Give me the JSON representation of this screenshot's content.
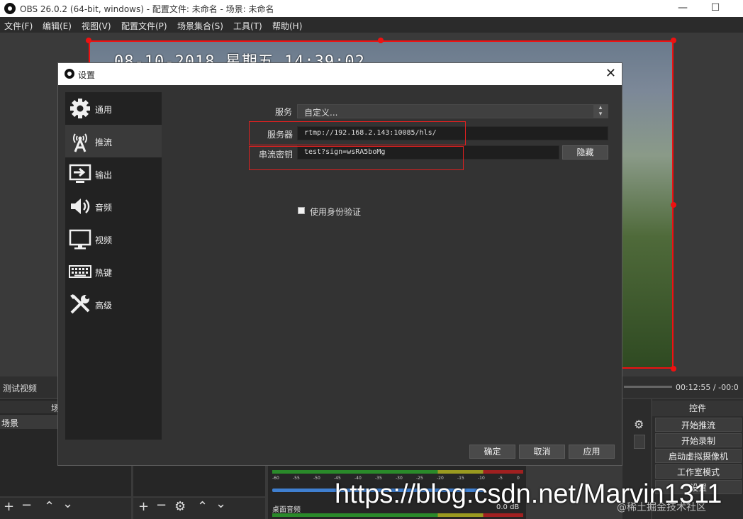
{
  "window": {
    "title": "OBS 26.0.2 (64-bit, windows) - 配置文件: 未命名 - 场景: 未命名",
    "minimize": "—",
    "maximize": "☐"
  },
  "menu": [
    "文件(F)",
    "编辑(E)",
    "视图(V)",
    "配置文件(P)",
    "场景集合(S)",
    "工具(T)",
    "帮助(H)"
  ],
  "preview": {
    "timestamp": "08-10-2018  星期五  14:39:02"
  },
  "dock": {
    "media_label": "测试视频",
    "time": "00:12:55 / -00:0",
    "scenes_header": "场",
    "scenes_item": "场景",
    "controls_header": "控件",
    "controls": [
      "开始推流",
      "开始录制",
      "启动虚拟摄像机",
      "工作室模式",
      "设置"
    ],
    "mixer_item": "桌面音频",
    "mixer_db": "0.0 dB",
    "ticks": [
      "-60",
      "-55",
      "-50",
      "-45",
      "-40",
      "-35",
      "-30",
      "-25",
      "-20",
      "-15",
      "-10",
      "-5",
      "0"
    ]
  },
  "dialog": {
    "title": "设置",
    "close": "✕",
    "sidebar": [
      {
        "label": "通用",
        "icon": "gear-icon"
      },
      {
        "label": "推流",
        "icon": "antenna-icon"
      },
      {
        "label": "输出",
        "icon": "output-icon"
      },
      {
        "label": "音频",
        "icon": "speaker-icon"
      },
      {
        "label": "视频",
        "icon": "monitor-icon"
      },
      {
        "label": "热键",
        "icon": "keyboard-icon"
      },
      {
        "label": "高级",
        "icon": "tools-icon"
      }
    ],
    "service_label": "服务",
    "service_value": "自定义...",
    "server_label": "服务器",
    "server_value": "rtmp://192.168.2.143:10085/hls/",
    "key_label": "串流密钥",
    "key_value": "test?sign=wsRA5boMg",
    "hide_button": "隐藏",
    "auth_label": "使用身份验证",
    "ok": "确定",
    "cancel": "取消",
    "apply": "应用"
  },
  "watermark": {
    "url": "https://blog.csdn.net/Marvin1311",
    "site": "@稀土掘金技术社区"
  }
}
